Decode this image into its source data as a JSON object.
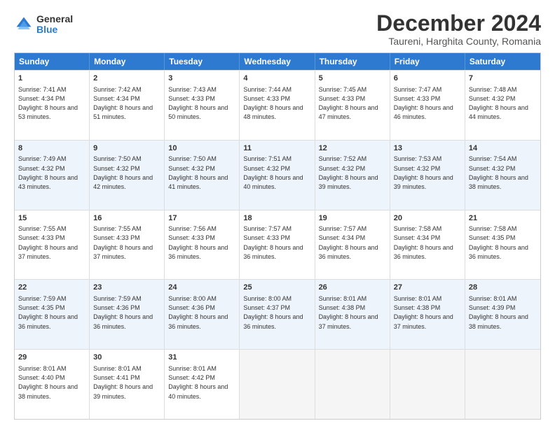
{
  "logo": {
    "general": "General",
    "blue": "Blue"
  },
  "title": "December 2024",
  "subtitle": "Taureni, Harghita County, Romania",
  "days": [
    "Sunday",
    "Monday",
    "Tuesday",
    "Wednesday",
    "Thursday",
    "Friday",
    "Saturday"
  ],
  "rows": [
    {
      "alt": false,
      "cells": [
        {
          "day": "1",
          "rise": "7:41 AM",
          "set": "4:34 PM",
          "daylight": "8 hours and 53 minutes."
        },
        {
          "day": "2",
          "rise": "7:42 AM",
          "set": "4:34 PM",
          "daylight": "8 hours and 51 minutes."
        },
        {
          "day": "3",
          "rise": "7:43 AM",
          "set": "4:33 PM",
          "daylight": "8 hours and 50 minutes."
        },
        {
          "day": "4",
          "rise": "7:44 AM",
          "set": "4:33 PM",
          "daylight": "8 hours and 48 minutes."
        },
        {
          "day": "5",
          "rise": "7:45 AM",
          "set": "4:33 PM",
          "daylight": "8 hours and 47 minutes."
        },
        {
          "day": "6",
          "rise": "7:47 AM",
          "set": "4:33 PM",
          "daylight": "8 hours and 46 minutes."
        },
        {
          "day": "7",
          "rise": "7:48 AM",
          "set": "4:32 PM",
          "daylight": "8 hours and 44 minutes."
        }
      ]
    },
    {
      "alt": true,
      "cells": [
        {
          "day": "8",
          "rise": "7:49 AM",
          "set": "4:32 PM",
          "daylight": "8 hours and 43 minutes."
        },
        {
          "day": "9",
          "rise": "7:50 AM",
          "set": "4:32 PM",
          "daylight": "8 hours and 42 minutes."
        },
        {
          "day": "10",
          "rise": "7:50 AM",
          "set": "4:32 PM",
          "daylight": "8 hours and 41 minutes."
        },
        {
          "day": "11",
          "rise": "7:51 AM",
          "set": "4:32 PM",
          "daylight": "8 hours and 40 minutes."
        },
        {
          "day": "12",
          "rise": "7:52 AM",
          "set": "4:32 PM",
          "daylight": "8 hours and 39 minutes."
        },
        {
          "day": "13",
          "rise": "7:53 AM",
          "set": "4:32 PM",
          "daylight": "8 hours and 39 minutes."
        },
        {
          "day": "14",
          "rise": "7:54 AM",
          "set": "4:32 PM",
          "daylight": "8 hours and 38 minutes."
        }
      ]
    },
    {
      "alt": false,
      "cells": [
        {
          "day": "15",
          "rise": "7:55 AM",
          "set": "4:33 PM",
          "daylight": "8 hours and 37 minutes."
        },
        {
          "day": "16",
          "rise": "7:55 AM",
          "set": "4:33 PM",
          "daylight": "8 hours and 37 minutes."
        },
        {
          "day": "17",
          "rise": "7:56 AM",
          "set": "4:33 PM",
          "daylight": "8 hours and 36 minutes."
        },
        {
          "day": "18",
          "rise": "7:57 AM",
          "set": "4:33 PM",
          "daylight": "8 hours and 36 minutes."
        },
        {
          "day": "19",
          "rise": "7:57 AM",
          "set": "4:34 PM",
          "daylight": "8 hours and 36 minutes."
        },
        {
          "day": "20",
          "rise": "7:58 AM",
          "set": "4:34 PM",
          "daylight": "8 hours and 36 minutes."
        },
        {
          "day": "21",
          "rise": "7:58 AM",
          "set": "4:35 PM",
          "daylight": "8 hours and 36 minutes."
        }
      ]
    },
    {
      "alt": true,
      "cells": [
        {
          "day": "22",
          "rise": "7:59 AM",
          "set": "4:35 PM",
          "daylight": "8 hours and 36 minutes."
        },
        {
          "day": "23",
          "rise": "7:59 AM",
          "set": "4:36 PM",
          "daylight": "8 hours and 36 minutes."
        },
        {
          "day": "24",
          "rise": "8:00 AM",
          "set": "4:36 PM",
          "daylight": "8 hours and 36 minutes."
        },
        {
          "day": "25",
          "rise": "8:00 AM",
          "set": "4:37 PM",
          "daylight": "8 hours and 36 minutes."
        },
        {
          "day": "26",
          "rise": "8:01 AM",
          "set": "4:38 PM",
          "daylight": "8 hours and 37 minutes."
        },
        {
          "day": "27",
          "rise": "8:01 AM",
          "set": "4:38 PM",
          "daylight": "8 hours and 37 minutes."
        },
        {
          "day": "28",
          "rise": "8:01 AM",
          "set": "4:39 PM",
          "daylight": "8 hours and 38 minutes."
        }
      ]
    },
    {
      "alt": false,
      "cells": [
        {
          "day": "29",
          "rise": "8:01 AM",
          "set": "4:40 PM",
          "daylight": "8 hours and 38 minutes."
        },
        {
          "day": "30",
          "rise": "8:01 AM",
          "set": "4:41 PM",
          "daylight": "8 hours and 39 minutes."
        },
        {
          "day": "31",
          "rise": "8:01 AM",
          "set": "4:42 PM",
          "daylight": "8 hours and 40 minutes."
        },
        null,
        null,
        null,
        null
      ]
    }
  ]
}
